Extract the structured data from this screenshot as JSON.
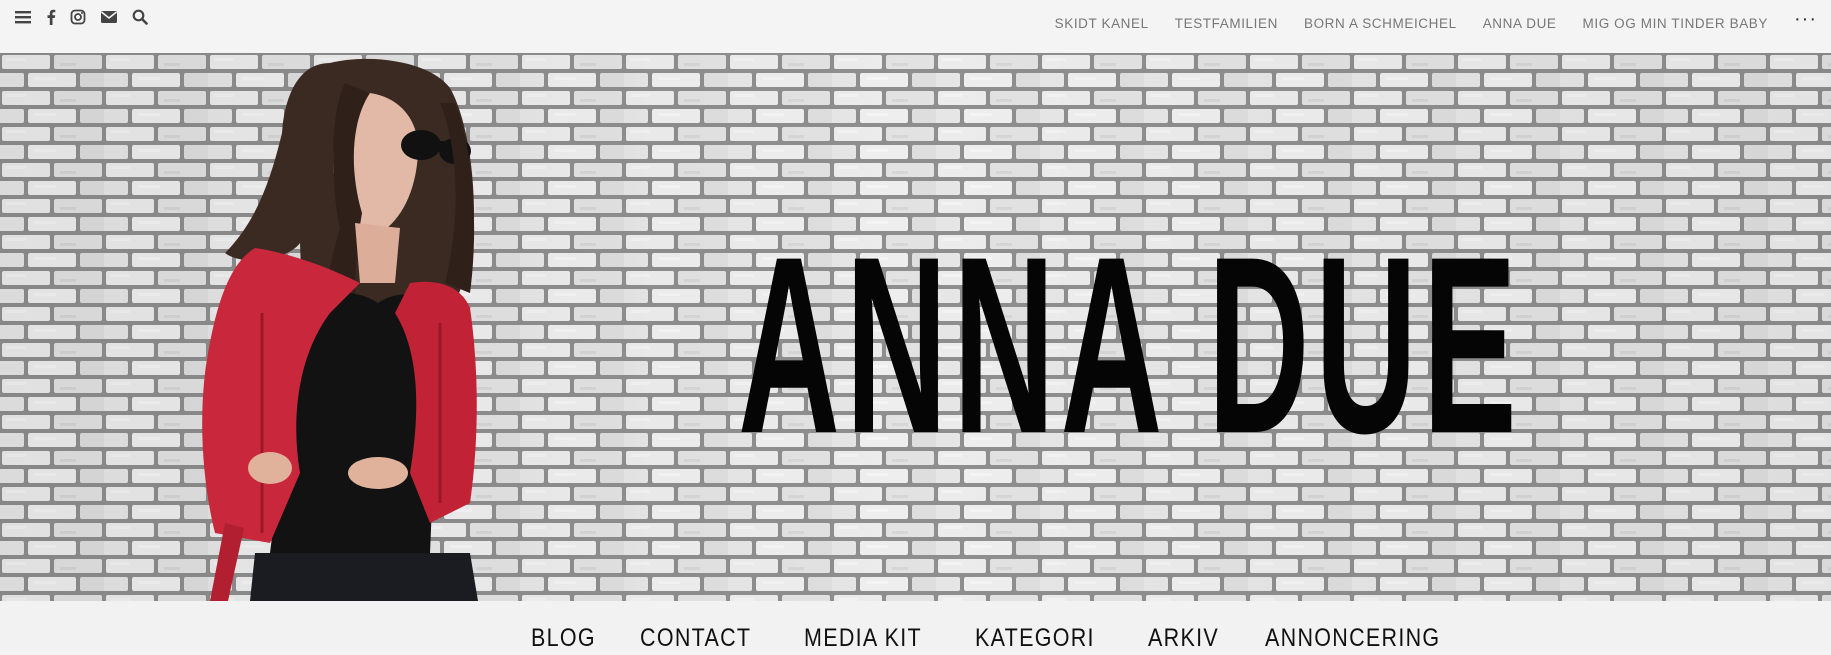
{
  "top_icons": [
    "menu-icon",
    "facebook-icon",
    "instagram-icon",
    "envelope-icon",
    "search-icon"
  ],
  "top_nav": {
    "links": [
      {
        "label": "SKIDT KANEL"
      },
      {
        "label": "TESTFAMILIEN"
      },
      {
        "label": "BORN A SCHMEICHEL"
      },
      {
        "label": "ANNA DUE"
      },
      {
        "label": "MIG OG MIN TINDER BABY"
      }
    ],
    "more_label": "···"
  },
  "banner": {
    "title": "ANNA DUE",
    "accent_color": "#c9283c",
    "brick_color": "#e6e6e6",
    "mortar_color": "#8a8a8a"
  },
  "main_nav": {
    "items": [
      {
        "label": "BLOG"
      },
      {
        "label": "CONTACT"
      },
      {
        "label": "MEDIA KIT"
      },
      {
        "label": "KATEGORI"
      },
      {
        "label": "ARKIV"
      },
      {
        "label": "ANNONCERING"
      }
    ]
  }
}
